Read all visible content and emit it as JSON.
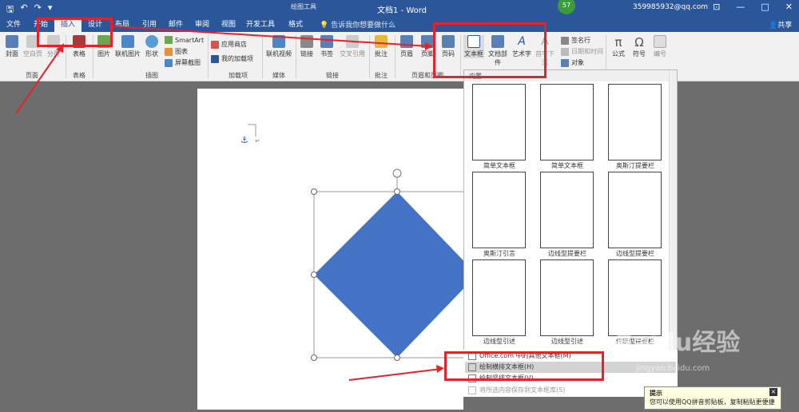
{
  "titlebar": {
    "drawing_tools": "绘图工具",
    "title": "文档1 - Word",
    "user": "359985932@qq.com",
    "badge": "57",
    "qa_save": "🖫",
    "qa_undo": "↶",
    "qa_redo": "↷",
    "qa_more": "▾",
    "win_min": "—",
    "win_restore": "□",
    "win_close": "✕",
    "win_ribbon": "⊡"
  },
  "tabs": [
    {
      "label": "文件"
    },
    {
      "label": "开始"
    },
    {
      "label": "插入"
    },
    {
      "label": "设计"
    },
    {
      "label": "布局"
    },
    {
      "label": "引用"
    },
    {
      "label": "邮件"
    },
    {
      "label": "审阅"
    },
    {
      "label": "视图"
    },
    {
      "label": "开发工具"
    },
    {
      "label": "格式"
    }
  ],
  "tellme": "告诉我你想要做什么",
  "share": "共享",
  "ribbon": {
    "buttons": {
      "cover": "封面",
      "blank": "空白页",
      "pagebreak": "分页",
      "table": "表格",
      "picture": "图片",
      "online_pic": "联机图片",
      "shapes": "形状",
      "online_video": "联机视频",
      "link": "链接",
      "bookmark": "书签",
      "crossref": "交叉引用",
      "comment": "批注",
      "header": "页眉",
      "footer": "页脚",
      "pagenum": "页码",
      "textbox": "文本框",
      "docparts": "文档部件",
      "wordart": "艺术字",
      "dropcap": "首字下沉",
      "formula": "公式",
      "symbol": "符号",
      "number": "编号"
    },
    "small": {
      "smartart": "SmartArt",
      "chart": "图表",
      "screenshot": "屏幕截图",
      "store": "应用商店",
      "myaddins": "我的加载项",
      "signature": "签名行",
      "datetime": "日期和时间",
      "object": "对象"
    },
    "groups": {
      "pages": "页面",
      "tables": "表格",
      "illustrations": "插图",
      "addins": "加载项",
      "media": "媒体",
      "links": "链接",
      "comments": "批注",
      "headerfooter": "页眉和页脚"
    }
  },
  "gallery": {
    "header": "内置",
    "captions": [
      "简单文本框",
      "简单文本框",
      "奥斯汀提要栏",
      "奥斯汀引言",
      "边线型提要栏",
      "边线型提要栏",
      "边线型引述",
      "边线型引述",
      "传统型提要栏"
    ]
  },
  "menu": {
    "office": "Office.com 中的其他文本框(M)",
    "draw_h": "绘制横排文本框(H)",
    "draw_v": "绘制竖排文本框(V)",
    "save": "将所选内容保存到文本框库(S)"
  },
  "popup": {
    "title": "提示",
    "text": "您可以使用QQ拼音剪贴板，复制粘贴更便捷"
  },
  "watermark": {
    "logo": "Baidu经验",
    "url": "jingyan.baidu.com"
  },
  "colors": {
    "accent": "#2b579a",
    "shape": "#4472c4",
    "highlight": "#e3232b"
  }
}
